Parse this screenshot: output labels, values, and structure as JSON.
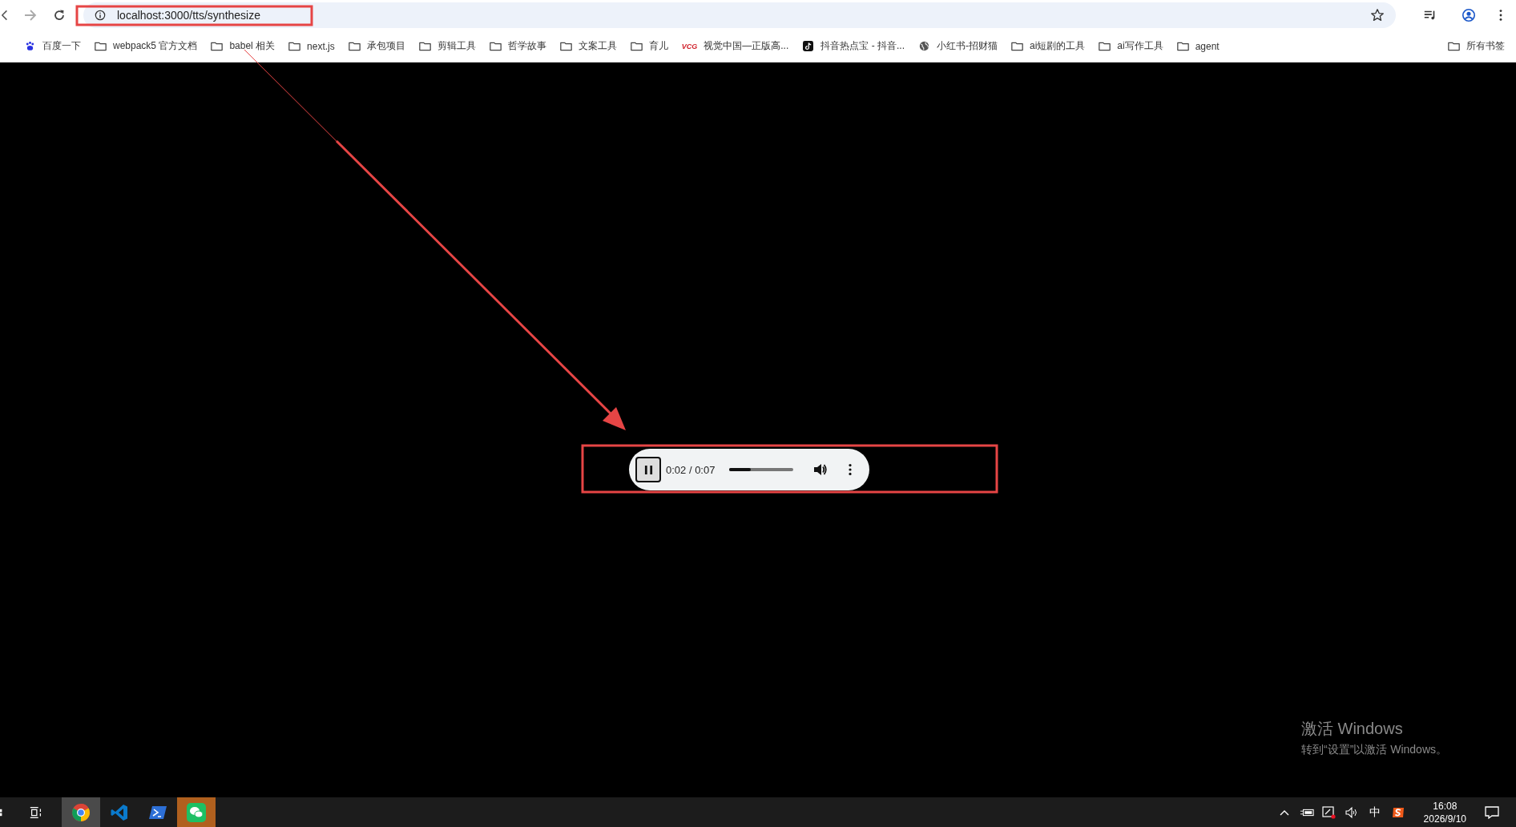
{
  "browser": {
    "url": "localhost:3000/tts/synthesize",
    "bookmarked": false
  },
  "bookmarks": [
    {
      "kind": "paw",
      "label": "百度一下"
    },
    {
      "kind": "folder",
      "label": "webpack5 官方文档"
    },
    {
      "kind": "folder",
      "label": "babel 相关"
    },
    {
      "kind": "folder",
      "label": "next.js"
    },
    {
      "kind": "folder",
      "label": "承包项目"
    },
    {
      "kind": "folder",
      "label": "剪辑工具"
    },
    {
      "kind": "folder",
      "label": "哲学故事"
    },
    {
      "kind": "folder",
      "label": "文案工具"
    },
    {
      "kind": "folder",
      "label": "育儿"
    },
    {
      "kind": "vcg",
      "label": "视觉中国—正版高...",
      "badge": "VCG"
    },
    {
      "kind": "note",
      "label": "抖音热点宝 - 抖音..."
    },
    {
      "kind": "globe",
      "label": "小红书-招财猫"
    },
    {
      "kind": "folder",
      "label": "ai短剧的工具"
    },
    {
      "kind": "folder",
      "label": "ai写作工具"
    },
    {
      "kind": "folder",
      "label": "agent"
    }
  ],
  "all_bookmarks": "所有书签",
  "player": {
    "playing": true,
    "time": "0:02 / 0:07",
    "level": 0.33,
    "muted": false
  },
  "activation": {
    "title": "激活 Windows",
    "subtitle": "转到“设置”以激活 Windows。"
  },
  "taskbar": {
    "apps": [
      {
        "kind": "chrome",
        "selected": true
      },
      {
        "kind": "vscode",
        "selected": false
      },
      {
        "kind": "terminal",
        "selected": false
      },
      {
        "kind": "wechat",
        "selected": false,
        "flashing": true
      }
    ],
    "ime": "中",
    "time": "16:08",
    "date": "2026/9/10"
  }
}
